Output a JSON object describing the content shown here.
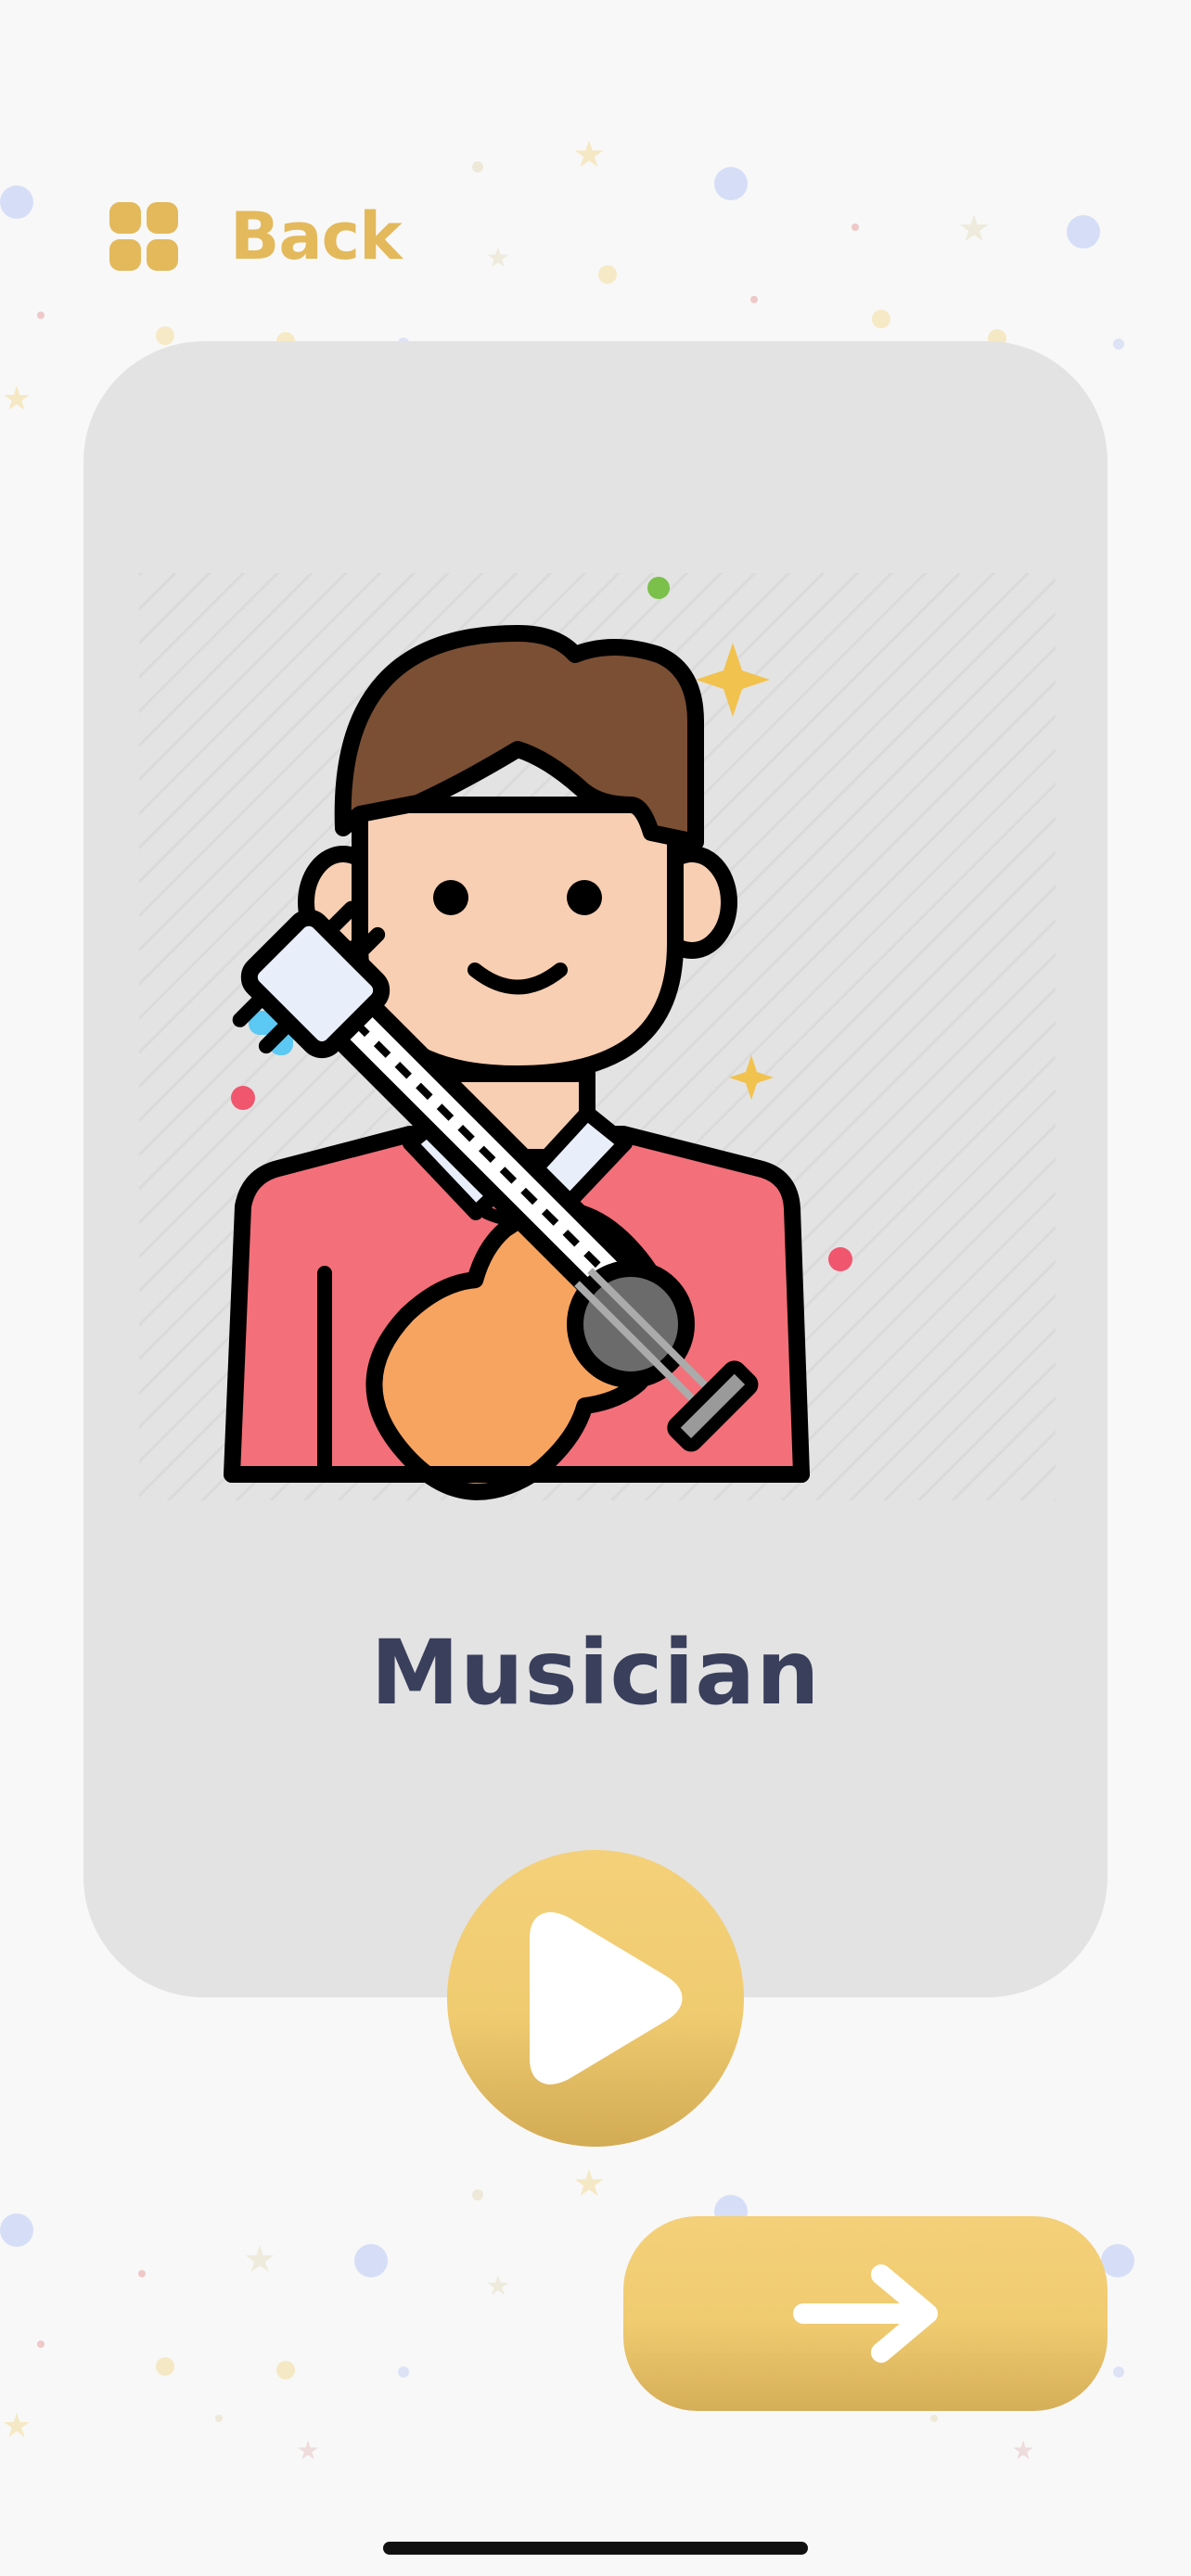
{
  "nav": {
    "back_label": "Back",
    "back_icon": "grid-icon"
  },
  "card": {
    "title": "Musician",
    "illustration": "musician-with-guitar-illustration"
  },
  "controls": {
    "play_icon": "play-icon",
    "next_icon": "arrow-right-icon"
  },
  "colors": {
    "accent_gold": "#f0cb70",
    "back_text": "#e3b95b",
    "title_text": "#3a3f5c",
    "card_bg": "#e3e3e3",
    "page_bg": "#f8f8f8"
  }
}
